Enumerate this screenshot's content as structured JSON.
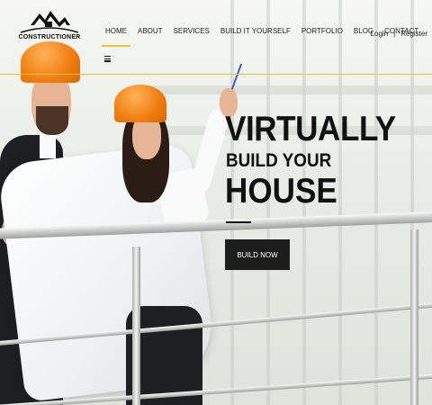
{
  "brand": {
    "name": "CONSTRUCTIONER"
  },
  "nav": {
    "items": [
      {
        "label": "HOME",
        "active": true
      },
      {
        "label": "ABOUT"
      },
      {
        "label": "SERVICES"
      },
      {
        "label": "BUILD IT YOURSELF"
      },
      {
        "label": "PORTFOLIO"
      },
      {
        "label": "BLOG"
      },
      {
        "label": "CONTACT"
      }
    ],
    "menu_icon": "hamburger-icon"
  },
  "auth": {
    "login": "Login",
    "separator": "|",
    "register": "Register"
  },
  "hero": {
    "line1": "VIRTUALLY",
    "line2": "BUILD YOUR",
    "line3": "HOUSE",
    "cta_label": "BUILD NOW"
  },
  "colors": {
    "accent": "#e8c23a",
    "cta_bg": "#1d1d1d",
    "text": "#111111",
    "hard_hat": "#f07d10"
  }
}
